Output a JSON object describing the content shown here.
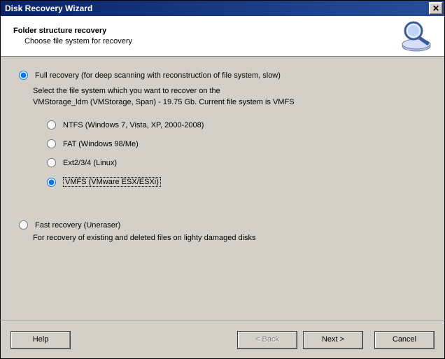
{
  "window": {
    "title": "Disk Recovery Wizard",
    "close_glyph": "✕"
  },
  "header": {
    "title": "Folder structure recovery",
    "subtitle": "Choose file system for recovery"
  },
  "full_recovery": {
    "label": "Full recovery (for deep scanning with reconstruction of file system, slow)",
    "desc_line1": "Select the file system which you want to recover on the",
    "desc_line2": "VMStorage_ldm (VMStorage, Span) - 19.75 Gb. Current file system is VMFS",
    "selected": true,
    "fs_options": [
      {
        "id": "ntfs",
        "label": "NTFS (Windows 7, Vista, XP, 2000-2008)",
        "selected": false
      },
      {
        "id": "fat",
        "label": "FAT (Windows 98/Me)",
        "selected": false
      },
      {
        "id": "ext",
        "label": "Ext2/3/4 (Linux)",
        "selected": false
      },
      {
        "id": "vmfs",
        "label": "VMFS (VMware ESX/ESXi)",
        "selected": true
      }
    ]
  },
  "fast_recovery": {
    "label": "Fast recovery (Uneraser)",
    "desc": "For recovery of existing and deleted files on lighty damaged disks",
    "selected": false
  },
  "footer": {
    "help": "Help",
    "back": "< Back",
    "next": "Next >",
    "cancel": "Cancel",
    "back_enabled": false
  },
  "icon_colors": {
    "glass_fill": "#9db8e8",
    "glass_stroke": "#3a5a9a",
    "base_fill": "#b9c7e6",
    "base_stroke": "#6a7aa8"
  }
}
